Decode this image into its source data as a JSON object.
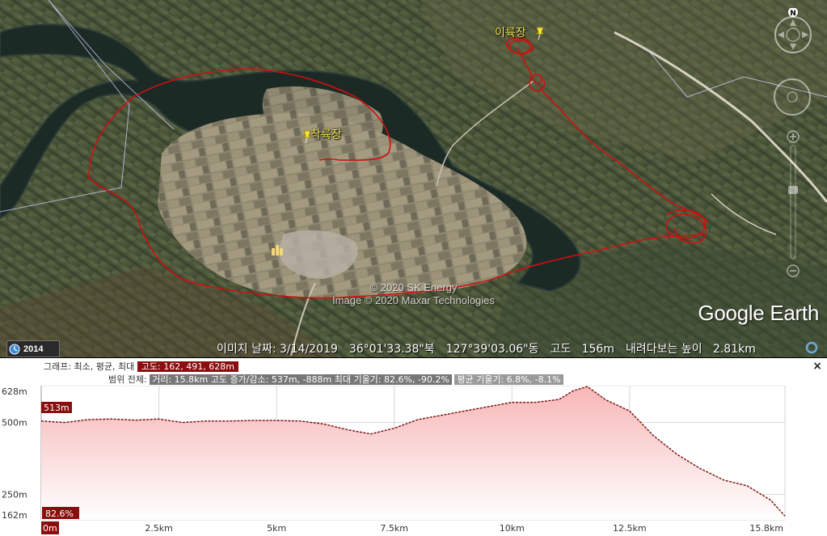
{
  "map": {
    "labels": [
      {
        "text": "이륙장",
        "name": "map-label-takeoff"
      },
      {
        "text": "착륙장",
        "name": "map-label-landing"
      }
    ],
    "copyright_line1": "© 2020 SK Energy",
    "copyright_line2": "Image © 2020 Maxar Technologies",
    "logo": "Google Earth",
    "compass_letter": "N",
    "track_color": "#d01010"
  },
  "status_bar": {
    "history_year": "2014",
    "image_date": "이미지 날짜: 3/14/2019",
    "latitude": "36°01'33.38\"북",
    "longitude": "127°39'03.06\"동",
    "altitude": "고도   156m",
    "eye_altitude": "내려다보는 높이   2.81km"
  },
  "profile": {
    "graph_prefix": "그래프: 최소, 평균, 최대",
    "graph_stat": "고도: 162, 491, 628m",
    "range_prefix": "범위 전체:",
    "range_stats": "거리: 15.8km 고도 증가/감소: 537m, -888m  최대 기울기: 82.6%, -90.2%",
    "avg_slope": "평균 기울기: 6.8%, -8.1%",
    "close_label": "×",
    "cursor_elev": "513m",
    "cursor_slope": "82.6%",
    "start_label": "0m"
  },
  "chart_data": {
    "type": "area",
    "title": "",
    "xlabel": "",
    "ylabel": "",
    "x_unit": "km",
    "y_unit": "m",
    "xlim": [
      0,
      15.8
    ],
    "ylim": [
      162,
      628
    ],
    "y_ticks": [
      {
        "value": 628,
        "label": "628m"
      },
      {
        "value": 500,
        "label": "500m"
      },
      {
        "value": 250,
        "label": "250m"
      },
      {
        "value": 162,
        "label": "162m"
      }
    ],
    "x_ticks": [
      {
        "value": 2.5,
        "label": "2.5km"
      },
      {
        "value": 5,
        "label": "5km"
      },
      {
        "value": 7.5,
        "label": "7.5km"
      },
      {
        "value": 10,
        "label": "10km"
      },
      {
        "value": 12.5,
        "label": "12.5km"
      },
      {
        "value": 15.8,
        "label": "15.8km"
      }
    ],
    "grid": true,
    "line_color": "#7a0a0a",
    "fill_top_color": "#f7b6b6",
    "fill_bottom_color": "#ffffff",
    "series": [
      {
        "x": [
          0,
          0.5,
          1.0,
          1.5,
          2.0,
          2.5,
          3.0,
          3.5,
          4.0,
          4.5,
          5.0,
          5.5,
          6.0,
          6.5,
          7.0,
          7.5,
          8.0,
          8.5,
          9.0,
          9.5,
          10.0,
          10.5,
          11.0,
          11.3,
          11.6,
          12.0,
          12.5,
          13.0,
          13.5,
          14.0,
          14.5,
          15.0,
          15.5,
          15.8
        ],
        "y": [
          505,
          500,
          510,
          512,
          508,
          512,
          500,
          505,
          505,
          507,
          507,
          505,
          495,
          475,
          460,
          480,
          510,
          525,
          540,
          555,
          570,
          570,
          580,
          610,
          625,
          578,
          540,
          455,
          390,
          340,
          300,
          280,
          230,
          175
        ]
      }
    ]
  }
}
